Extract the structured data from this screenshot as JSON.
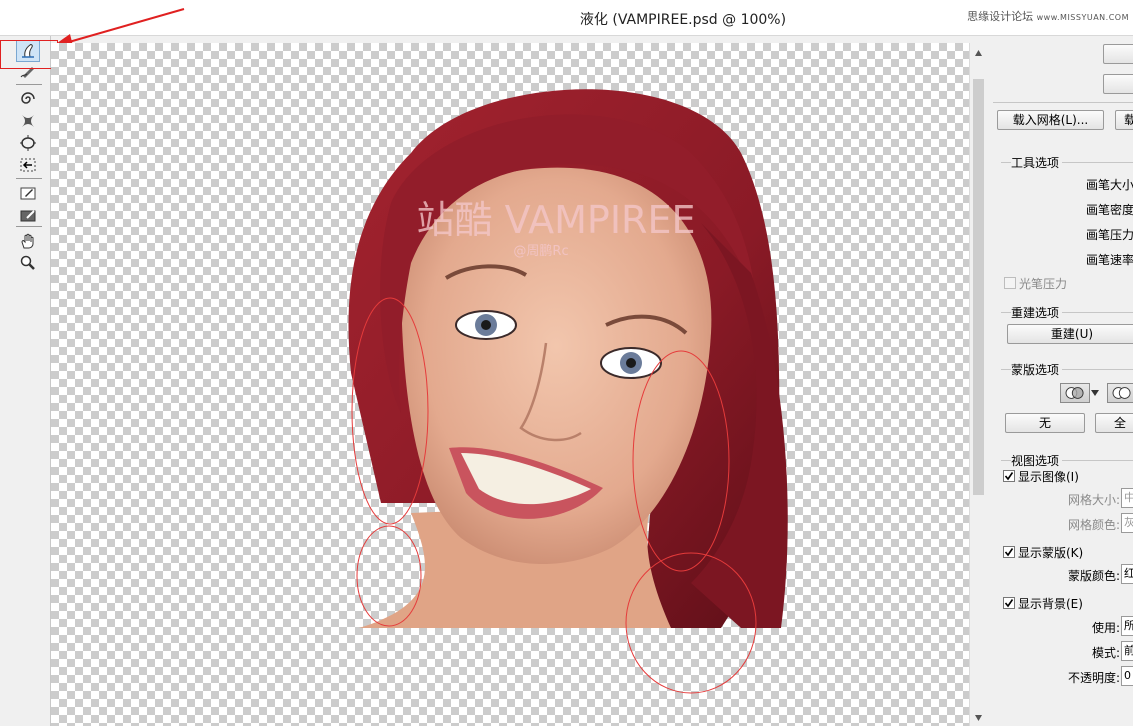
{
  "window": {
    "title": "液化 (VAMPIREE.psd @ 100%)",
    "watermark_cn": "思缘设计论坛",
    "watermark_url": "www.MISSYUAN.COM"
  },
  "toolbar": {
    "tools": [
      {
        "name": "forward-warp-tool",
        "active": true
      },
      {
        "name": "reconstruct-tool"
      },
      {
        "name": "twirl-clockwise-tool"
      },
      {
        "name": "pucker-tool"
      },
      {
        "name": "bloat-tool"
      },
      {
        "name": "push-left-tool"
      },
      {
        "name": "freeze-mask-tool"
      },
      {
        "name": "thaw-mask-tool"
      },
      {
        "name": "hand-tool"
      },
      {
        "name": "zoom-tool"
      }
    ]
  },
  "canvas": {
    "overlay_title": "站酷 VAMPIREE",
    "overlay_credit": "@周鹏Rc",
    "colors": {
      "hair": "#8e1c28",
      "skin": "#e9b49a",
      "annotation": "#e53b3b"
    }
  },
  "panel": {
    "load_mesh_button": "载入网格(L)...",
    "load_last_button_partial": "载",
    "tool_options": {
      "title": "工具选项",
      "brush_size": "画笔大小",
      "brush_density": "画笔密度",
      "brush_pressure": "画笔压力",
      "brush_rate": "画笔速率",
      "stylus_pressure": "光笔压力"
    },
    "reconstruct_options": {
      "title": "重建选项",
      "reconstruct_button": "重建(U)"
    },
    "mask_options": {
      "title": "蒙版选项",
      "none_button": "无",
      "all_button_partial": "全"
    },
    "view_options": {
      "title": "视图选项",
      "show_image": "显示图像(I)",
      "mesh_size": "网格大小:",
      "mesh_size_value": "中",
      "mesh_color": "网格颜色:",
      "mesh_color_value": "灰",
      "show_mask": "显示蒙版(K)",
      "mask_color": "蒙版颜色:",
      "mask_color_value": "红",
      "show_backdrop": "显示背景(E)",
      "use": "使用:",
      "use_value": "所",
      "mode": "模式:",
      "mode_value": "前",
      "opacity": "不透明度:",
      "opacity_value": "0"
    }
  }
}
